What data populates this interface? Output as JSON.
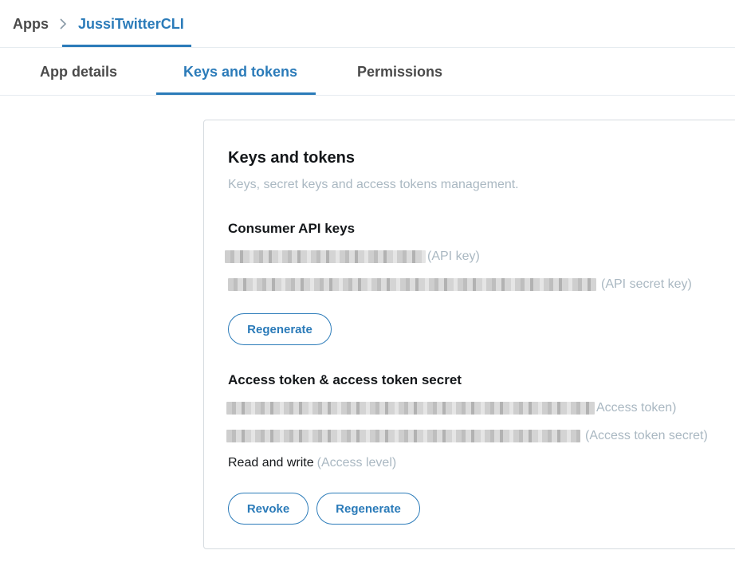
{
  "breadcrumb": {
    "root": "Apps",
    "current": "JussiTwitterCLI",
    "separator_icon": "chevron-right-icon"
  },
  "tabs": [
    {
      "label": "App details",
      "active": false
    },
    {
      "label": "Keys and tokens",
      "active": true
    },
    {
      "label": "Permissions",
      "active": false
    }
  ],
  "card": {
    "title": "Keys and tokens",
    "subtitle": "Keys, secret keys and access tokens management.",
    "consumer": {
      "title": "Consumer API keys",
      "api_key_hint": "(API key)",
      "api_secret_hint": "(API secret key)",
      "regenerate_label": "Regenerate"
    },
    "access": {
      "title": "Access token & access token secret",
      "token_hint": "Access token)",
      "secret_hint": "(Access token secret)",
      "level_value": "Read and write",
      "level_hint": "(Access level)",
      "revoke_label": "Revoke",
      "regenerate_label": "Regenerate"
    }
  },
  "colors": {
    "accent": "#2b7bb9",
    "muted": "#aab8c2",
    "border": "#d6dbe0"
  }
}
